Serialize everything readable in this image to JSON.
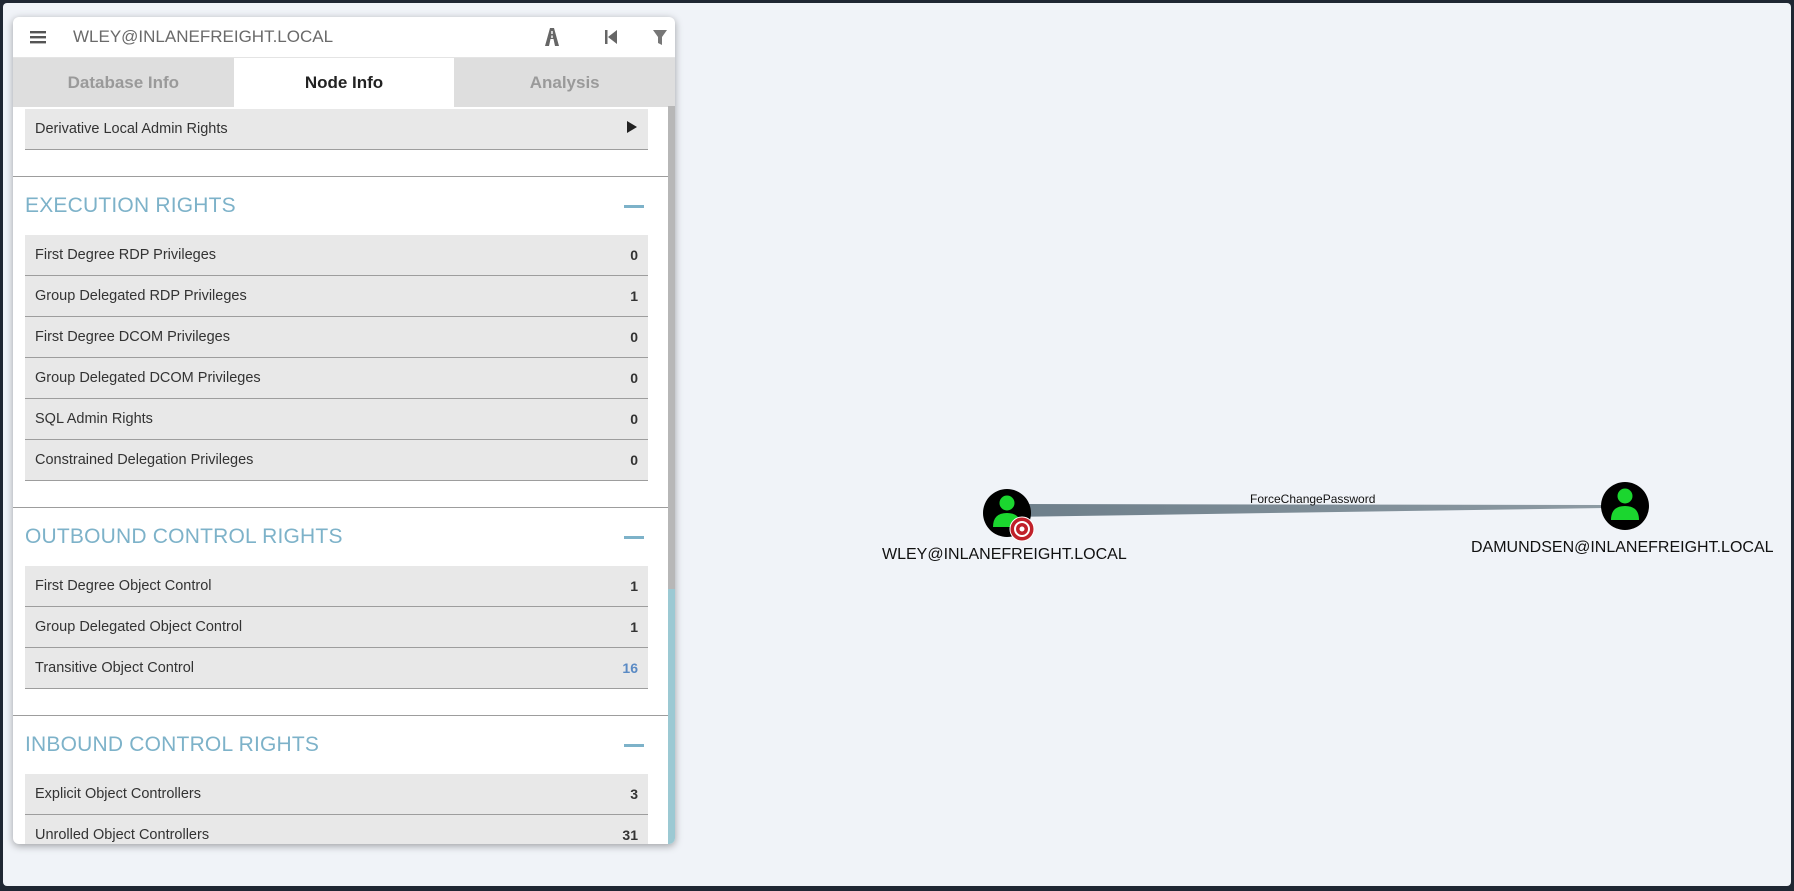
{
  "search": {
    "value": "WLEY@INLANEFREIGHT.LOCAL"
  },
  "toolbar": {
    "icons": [
      "menu-icon",
      "pathfinding-icon",
      "back-icon",
      "filter-icon"
    ]
  },
  "tabs": [
    {
      "label": "Database Info",
      "active": false
    },
    {
      "label": "Node Info",
      "active": true
    },
    {
      "label": "Analysis",
      "active": false
    }
  ],
  "top_row": {
    "label": "Derivative Local Admin Rights",
    "icon": "play-arrow-icon"
  },
  "sections": {
    "execution": {
      "title": "EXECUTION RIGHTS",
      "rows": [
        {
          "label": "First Degree RDP Privileges",
          "value": "0"
        },
        {
          "label": "Group Delegated RDP Privileges",
          "value": "1"
        },
        {
          "label": "First Degree DCOM Privileges",
          "value": "0"
        },
        {
          "label": "Group Delegated DCOM Privileges",
          "value": "0"
        },
        {
          "label": "SQL Admin Rights",
          "value": "0"
        },
        {
          "label": "Constrained Delegation Privileges",
          "value": "0"
        }
      ]
    },
    "outbound": {
      "title": "OUTBOUND CONTROL RIGHTS",
      "rows": [
        {
          "label": "First Degree Object Control",
          "value": "1"
        },
        {
          "label": "Group Delegated Object Control",
          "value": "1"
        },
        {
          "label": "Transitive Object Control",
          "value": "16"
        }
      ]
    },
    "inbound": {
      "title": "INBOUND CONTROL RIGHTS",
      "rows": [
        {
          "label": "Explicit Object Controllers",
          "value": "3"
        },
        {
          "label": "Unrolled Object Controllers",
          "value": "31"
        }
      ]
    }
  },
  "graph": {
    "source_node": "WLEY@INLANEFREIGHT.LOCAL",
    "target_node": "DAMUNDSEN@INLANEFREIGHT.LOCAL",
    "edge_label": "ForceChangePassword",
    "colors": {
      "node_fill": "#000000",
      "user_icon": "#1bd62f",
      "target_badge": "#c0202a",
      "edge": "#74848f"
    }
  }
}
